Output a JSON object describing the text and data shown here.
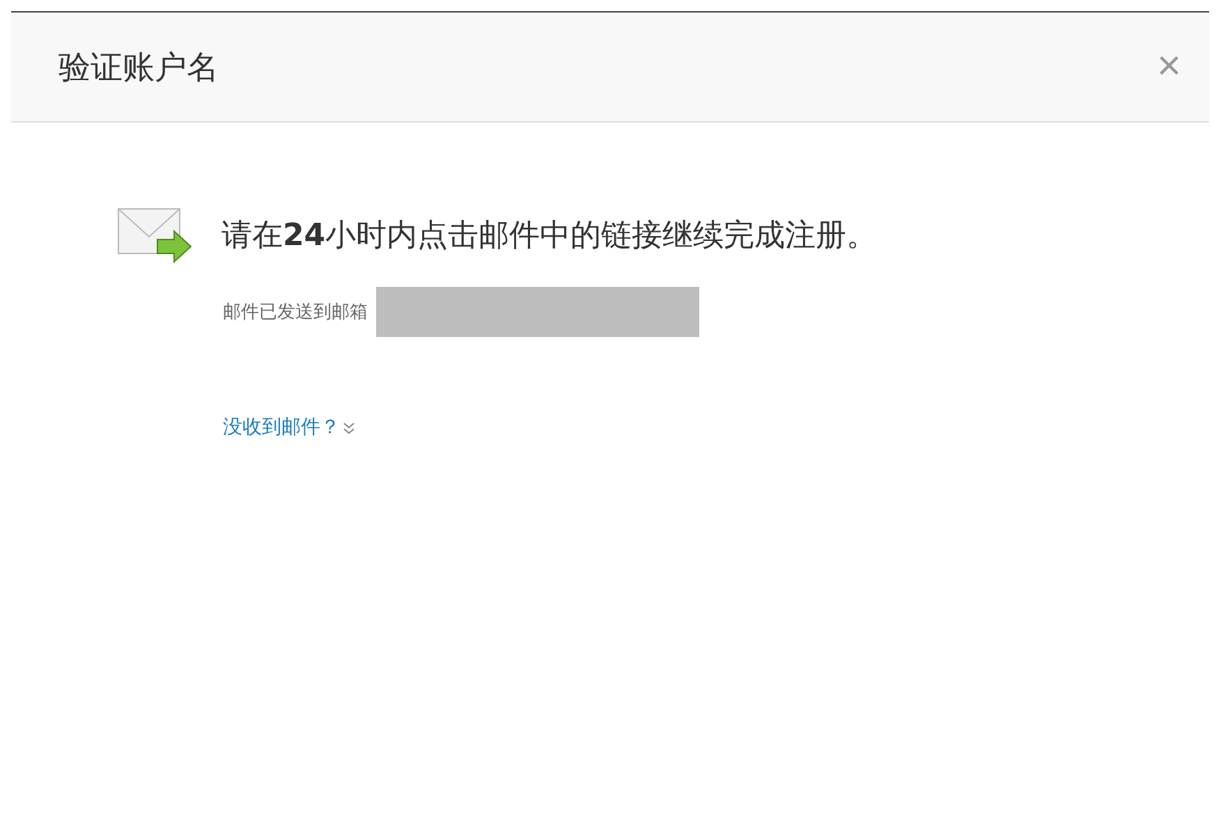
{
  "dialog": {
    "title": "验证账户名",
    "close": "×"
  },
  "message": {
    "headline": "请在**24**小时内点击邮件中的链接继续完成注册。",
    "sent_label": "邮件已发送到邮箱"
  },
  "help_link": {
    "label": "没收到邮件？",
    "expanded": false
  }
}
